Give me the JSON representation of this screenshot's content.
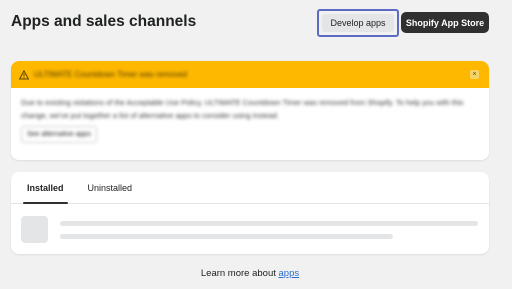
{
  "header": {
    "title": "Apps and sales channels",
    "develop_apps_label": "Develop apps",
    "app_store_label": "Shopify App Store"
  },
  "banner": {
    "icon": "warning-icon",
    "title": "ULTIMATE Countdown Timer was removed",
    "body": "Due to existing violations of the Acceptable Use Policy, ULTIMATE Countdown Timer was removed from Shopify. To help you with this change, we've put together a list of alternative apps to consider using instead.",
    "link_label": "See alternative apps",
    "close_symbol": "×",
    "color": "#ffb800"
  },
  "tabs": [
    {
      "label": "Installed",
      "active": true
    },
    {
      "label": "Uninstalled",
      "active": false
    }
  ],
  "footer": {
    "prefix": "Learn more about ",
    "link_label": "apps"
  },
  "colors": {
    "page_bg": "#f1f1f1",
    "focus_outline": "#5c6ac4",
    "primary_button": "#303030",
    "link": "#2c6ecb"
  }
}
